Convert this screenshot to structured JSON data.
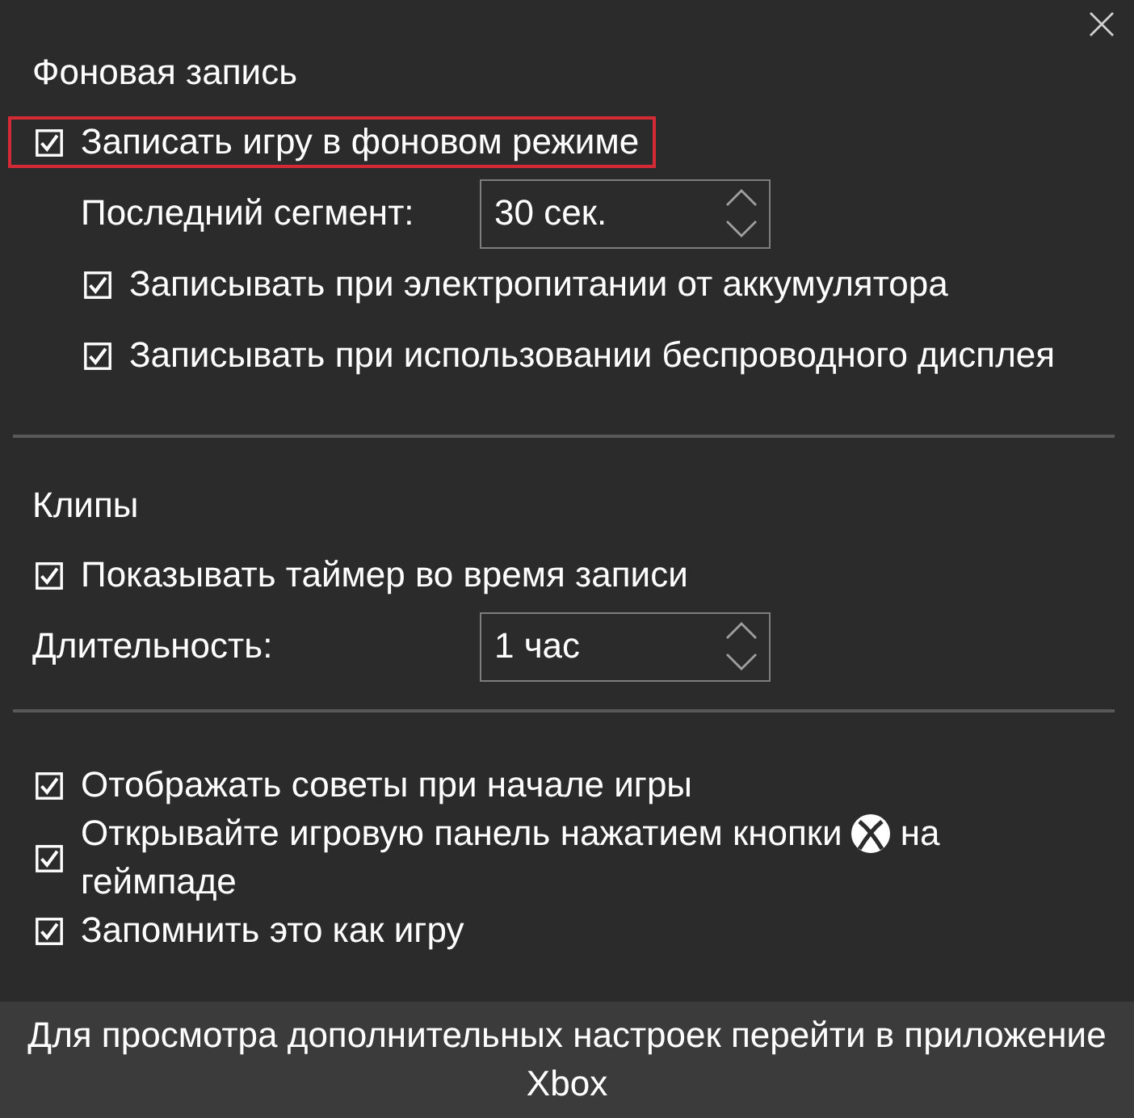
{
  "sections": [
    {
      "title": "Фоновая запись",
      "items": [
        {
          "kind": "checkbox",
          "label": "Записать игру в фоновом режиме",
          "checked": true,
          "highlighted": true,
          "children": [
            {
              "kind": "spinner",
              "label": "Последний сегмент:",
              "value": "30 сек."
            },
            {
              "kind": "checkbox",
              "label": "Записывать при электропитании от аккумулятора",
              "checked": true,
              "highlighted": false
            },
            {
              "kind": "checkbox",
              "label": "Записывать при использовании беспроводного дисплея",
              "checked": true,
              "highlighted": false
            }
          ]
        }
      ]
    },
    {
      "title": "Клипы",
      "items": [
        {
          "kind": "checkbox",
          "label": "Показывать таймер во время записи",
          "checked": true,
          "highlighted": false
        },
        {
          "kind": "spinner",
          "label": "Длительность:",
          "value": "1 час"
        }
      ]
    },
    {
      "items": [
        {
          "kind": "checkbox",
          "label": "Отображать советы при начале игры",
          "checked": true,
          "highlighted": false
        },
        {
          "kind": "button-hint",
          "label": "Открывайте игровую панель нажатием кнопки",
          "label_after_icon": "на",
          "label_next_line": "геймпаде",
          "checked": true,
          "highlighted": false
        },
        {
          "kind": "checkbox",
          "label": "Запомнить это как игру",
          "checked": true,
          "highlighted": false
        }
      ]
    }
  ],
  "footer": {
    "text": "Для просмотра дополнительных настроек перейти в приложение Xbox"
  }
}
